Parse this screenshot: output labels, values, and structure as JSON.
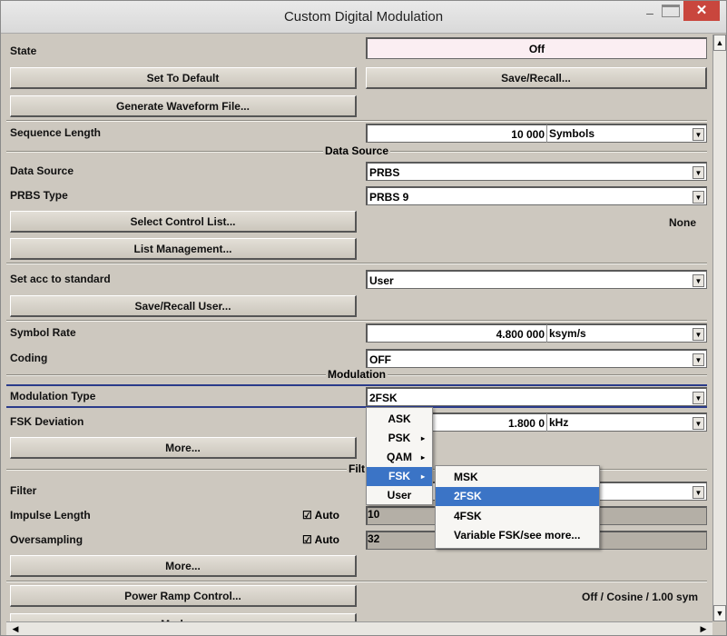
{
  "window": {
    "title": "Custom Digital Modulation",
    "minimize": "–",
    "close": "✕"
  },
  "rows": {
    "state": {
      "label": "State",
      "value": "Off"
    },
    "set_default": {
      "label": "Set To Default"
    },
    "save_recall": {
      "label": "Save/Recall..."
    },
    "gen_waveform": {
      "label": "Generate Waveform File..."
    },
    "seq_length": {
      "label": "Sequence Length",
      "value": "10 000",
      "unit": "Symbols"
    },
    "data_source_section": {
      "title": "Data Source"
    },
    "data_source": {
      "label": "Data Source",
      "value": "PRBS"
    },
    "prbs_type": {
      "label": "PRBS Type",
      "value": "PRBS 9"
    },
    "select_control_list": {
      "label": "Select Control List...",
      "value": "None"
    },
    "list_management": {
      "label": "List Management..."
    },
    "set_acc_standard": {
      "label": "Set acc to standard",
      "value": "User"
    },
    "save_recall_user": {
      "label": "Save/Recall User..."
    },
    "symbol_rate": {
      "label": "Symbol Rate",
      "value": "4.800 000",
      "unit": "ksym/s"
    },
    "coding": {
      "label": "Coding",
      "value": "OFF"
    },
    "modulation_section": {
      "title": "Modulation"
    },
    "modulation_type": {
      "label": "Modulation Type",
      "value": "2FSK"
    },
    "fsk_deviation": {
      "label": "FSK Deviation",
      "value": "1.800 0",
      "unit": "kHz"
    },
    "more1": {
      "label": "More..."
    },
    "filter_section": {
      "title": "Filt"
    },
    "filter": {
      "label": "Filter"
    },
    "impulse_length": {
      "label": "Impulse Length",
      "auto": "Auto",
      "value": "10"
    },
    "oversampling": {
      "label": "Oversampling",
      "auto": "Auto",
      "value": "32"
    },
    "more2": {
      "label": "More..."
    },
    "power_ramp": {
      "label": "Power Ramp Control...",
      "value": "Off / Cosine / 1.00 sym"
    },
    "marker": {
      "label": "Marker..."
    }
  },
  "menu": {
    "items": [
      {
        "label": "ASK",
        "arrow": ""
      },
      {
        "label": "PSK",
        "arrow": "▸"
      },
      {
        "label": "QAM",
        "arrow": "▸"
      },
      {
        "label": "FSK",
        "arrow": "▸"
      },
      {
        "label": "User",
        "arrow": ""
      }
    ],
    "selected": "FSK"
  },
  "submenu": {
    "items": [
      {
        "label": "MSK"
      },
      {
        "label": "2FSK"
      },
      {
        "label": "4FSK"
      },
      {
        "label": "Variable FSK/see more..."
      }
    ],
    "selected": "2FSK"
  },
  "icons": {
    "dropdown": "▼",
    "check": "☑",
    "scroll_up": "▲",
    "scroll_down": "▼",
    "scroll_left": "◀",
    "scroll_right": "▶"
  },
  "colors": {
    "background": "#cdc8bf",
    "selection": "#3b74c6",
    "close_button": "#c9463d",
    "state_field": "#fbeef2"
  }
}
